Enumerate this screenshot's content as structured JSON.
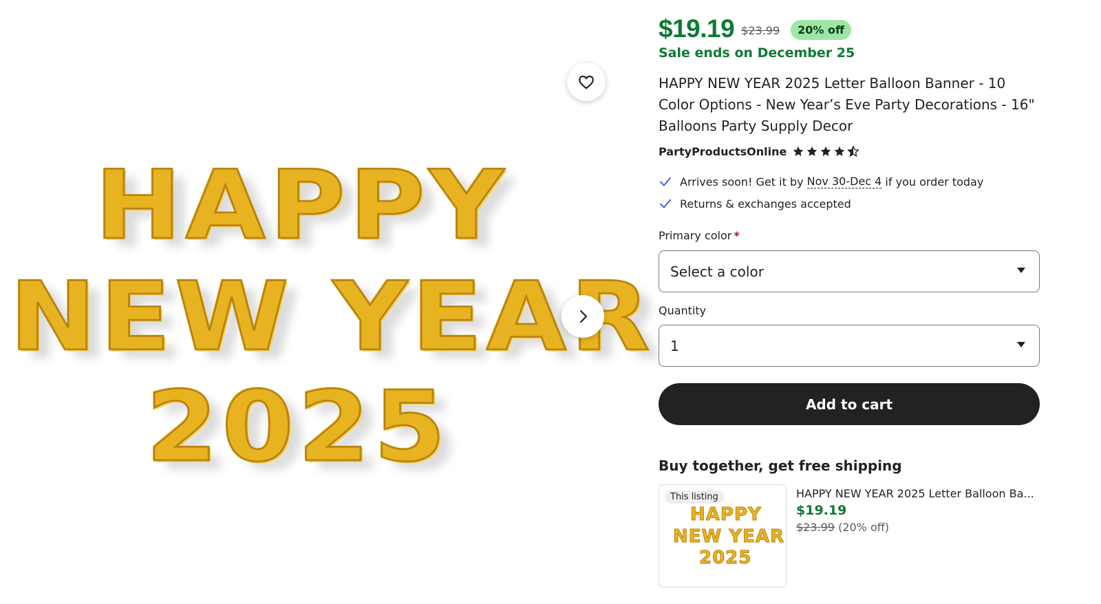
{
  "gallery": {
    "balloon_words": [
      "HAPPY",
      "NEW YEAR",
      "2025"
    ],
    "favorite_icon": "heart-icon",
    "next_icon": "chevron-right-icon"
  },
  "buybox": {
    "price": "$19.19",
    "original_price": "$23.99",
    "discount": "20% off",
    "sale_ends": "Sale ends on December 25",
    "title": "HAPPY NEW YEAR 2025 Letter Balloon Banner - 10 Color Options - New Year’s Eve Party Decorations - 16\" Balloons Party Supply Decor",
    "seller": "PartyProductsOnline",
    "rating": 4.5,
    "perks": {
      "arrival_prefix": "Arrives soon! Get it by ",
      "arrival_dates": "Nov 30-Dec 4",
      "arrival_suffix": " if you order today",
      "returns": "Returns & exchanges accepted"
    },
    "primary_color": {
      "label": "Primary color",
      "required_mark": "*",
      "value": "Select a color"
    },
    "quantity": {
      "label": "Quantity",
      "value": "1"
    },
    "add_to_cart": "Add to cart"
  },
  "bundle": {
    "heading": "Buy together, get free shipping",
    "tag": "This listing",
    "title": "HAPPY NEW YEAR 2025 Letter Balloon Ba...",
    "price": "$19.19",
    "original_price": "$23.99",
    "discount": "(20% off)"
  },
  "colors": {
    "sale_green": "#0e7a34",
    "badge_green": "#9ee5a6",
    "button_dark": "#222222",
    "check_blue": "#2f5bd3",
    "balloon_gold": "#e8b320"
  }
}
